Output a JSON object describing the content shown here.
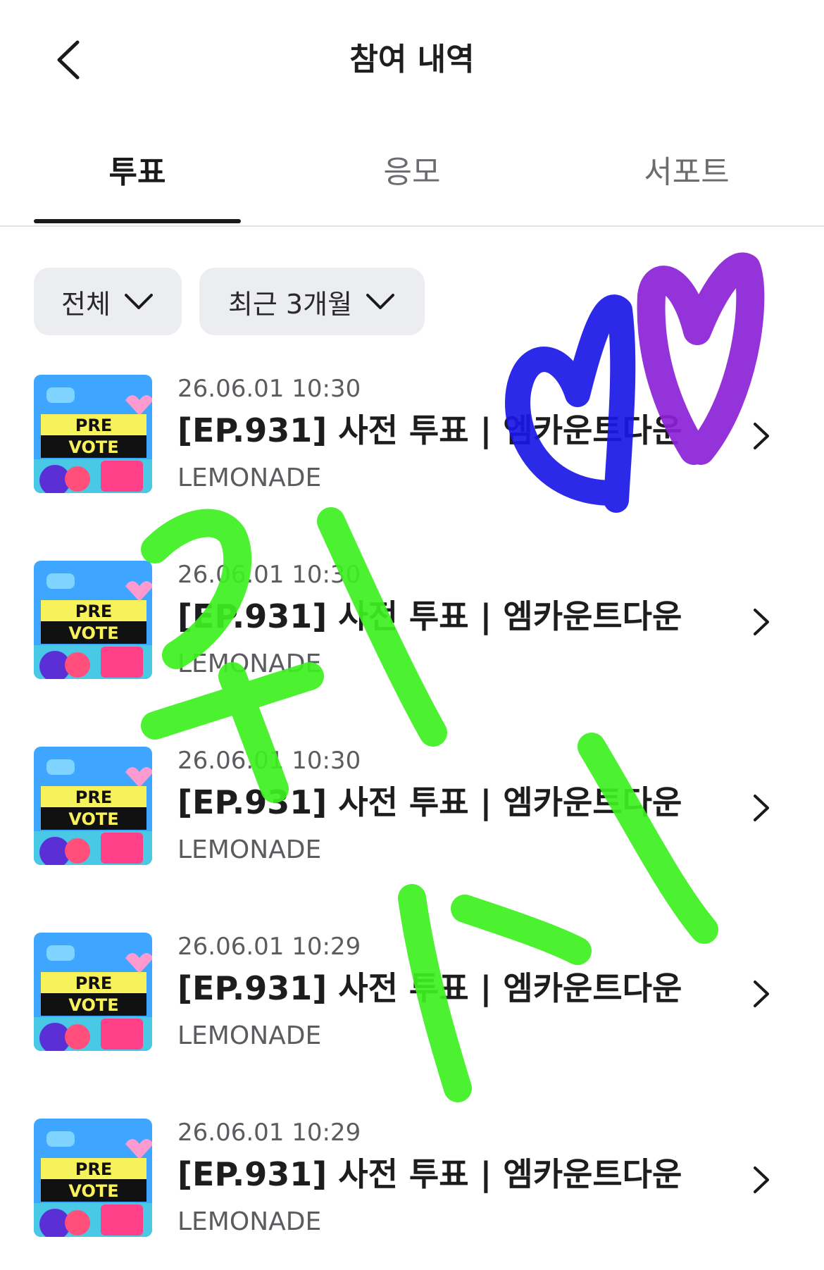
{
  "header": {
    "title": "참여 내역"
  },
  "tabs": [
    {
      "label": "투표",
      "active": true
    },
    {
      "label": "응모",
      "active": false
    },
    {
      "label": "서포트",
      "active": false
    }
  ],
  "filters": {
    "type_label": "전체",
    "period_label": "최근 3개월"
  },
  "thumbnail": {
    "line1": "PRE",
    "line2": "VOTE"
  },
  "items": [
    {
      "date": "26.06.01 10:30",
      "title": "[EP.931] 사전 투표 | 엠카운트다운",
      "brand": "LEMONADE"
    },
    {
      "date": "26.06.01 10:30",
      "title": "[EP.931] 사전 투표 | 엠카운트다운",
      "brand": "LEMONADE"
    },
    {
      "date": "26.06.01 10:30",
      "title": "[EP.931] 사전 투표 | 엠카운트다운",
      "brand": "LEMONADE"
    },
    {
      "date": "26.06.01 10:29",
      "title": "[EP.931] 사전 투표 | 엠카운트다운",
      "brand": "LEMONADE"
    },
    {
      "date": "26.06.01 10:29",
      "title": "[EP.931] 사전 투표 | 엠카운트다운",
      "brand": "LEMONADE"
    }
  ],
  "colors": {
    "text_primary": "#1f1f1f",
    "text_secondary": "#5b5b60",
    "filter_bg": "#ecedf0",
    "scribble_green": "#3df01f",
    "scribble_blue": "#1a18e6",
    "scribble_purple": "#8a22d6"
  }
}
